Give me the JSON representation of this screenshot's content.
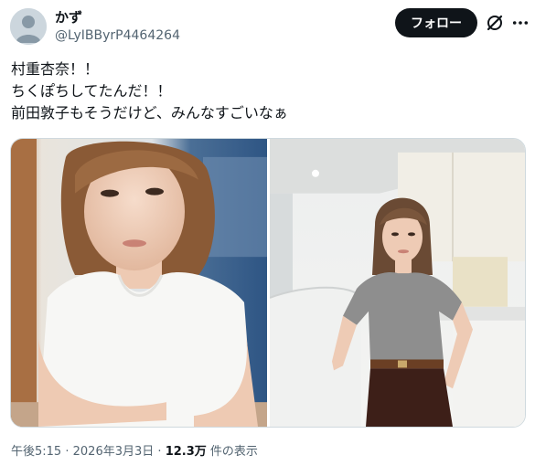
{
  "author": {
    "display_name": "かず",
    "handle": "@LyIBByrP4464264",
    "avatar_icon": "default-avatar-icon"
  },
  "header": {
    "follow_label": "フォロー",
    "grok_icon": "grok-icon",
    "more_icon": "more-icon"
  },
  "tweet": {
    "lines": [
      "村重杏奈！！",
      "ちくぽちしてたんだ！！",
      "前田敦子もそうだけど、みんなすごいなぁ"
    ]
  },
  "media": {
    "photos": [
      {
        "name": "photo-woman-white-tshirt"
      },
      {
        "name": "photo-woman-gray-knit"
      }
    ]
  },
  "meta": {
    "time": "午後5:15",
    "separator": "·",
    "date": "2026年3月3日",
    "views_count": "12.3万",
    "views_label": "件の表示"
  },
  "colors": {
    "text": "#0f1419",
    "secondary": "#536471",
    "button_bg": "#0f1419",
    "border": "#cfd9de"
  }
}
